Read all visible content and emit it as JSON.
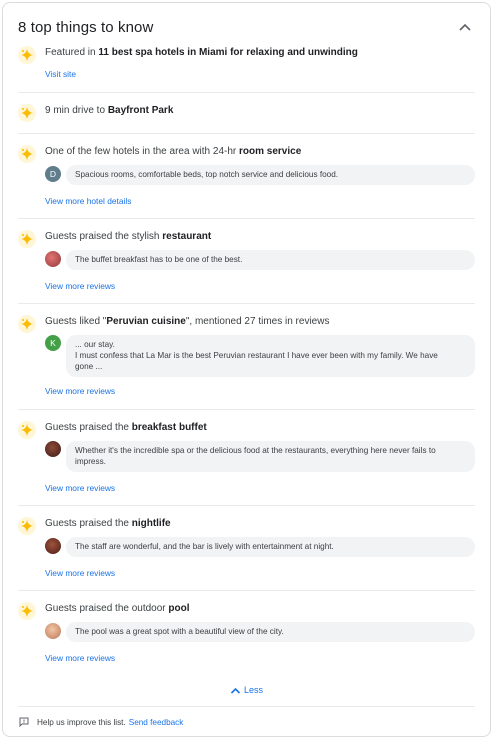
{
  "header": {
    "title": "8 top things to know"
  },
  "items": [
    {
      "pre": "Featured in ",
      "bold": "11 best spa hotels in Miami for relaxing and unwinding",
      "post": "",
      "link": "Visit site"
    },
    {
      "pre": "9 min drive to ",
      "bold": "Bayfront Park",
      "post": ""
    },
    {
      "pre": "One of the few hotels in the area with 24-hr ",
      "bold": "room service",
      "post": "",
      "avatar_letter": "D",
      "quote": "Spacious rooms, comfortable beds, top notch service and delicious food.",
      "link": "View more hotel details"
    },
    {
      "pre": "Guests praised the stylish ",
      "bold": "restaurant",
      "post": "",
      "quote": "The buffet breakfast has to be one of the best.",
      "link": "View more reviews"
    },
    {
      "pre": "Guests liked \"",
      "bold": "Peruvian cuisine",
      "post": "\", mentioned 27 times in reviews",
      "avatar_letter": "K",
      "quote_line1": "... our stay.",
      "quote_line2": "I must confess that La Mar is the best Peruvian restaurant I have ever been with my family. We have",
      "quote_line3": "gone ...",
      "link": "View more reviews"
    },
    {
      "pre": "Guests praised the ",
      "bold": "breakfast buffet",
      "post": "",
      "quote_line1": "Whether it's the incredible spa or the delicious food at the restaurants, everything here never fails to",
      "quote_line2": "impress.",
      "link": "View more reviews"
    },
    {
      "pre": "Guests praised the ",
      "bold": "nightlife",
      "post": "",
      "quote": "The staff are wonderful, and the bar is lively with entertainment at night.",
      "link": "View more reviews"
    },
    {
      "pre": "Guests praised the outdoor ",
      "bold": "pool",
      "post": "",
      "quote": "The pool was a great spot with a beautiful view of the city.",
      "link": "View more reviews"
    }
  ],
  "less_label": "Less",
  "footer": {
    "text": "Help us improve this list.",
    "feedback_link": "Send feedback"
  },
  "colors": {
    "link": "#1a73e8",
    "spark_bg": "#fef6d6",
    "spark": "#fbbc04",
    "bubble": "#f1f3f4"
  },
  "icons": {
    "item": "sparkle-icon",
    "collapse": "chevron-up-icon",
    "feedback": "feedback-icon"
  }
}
